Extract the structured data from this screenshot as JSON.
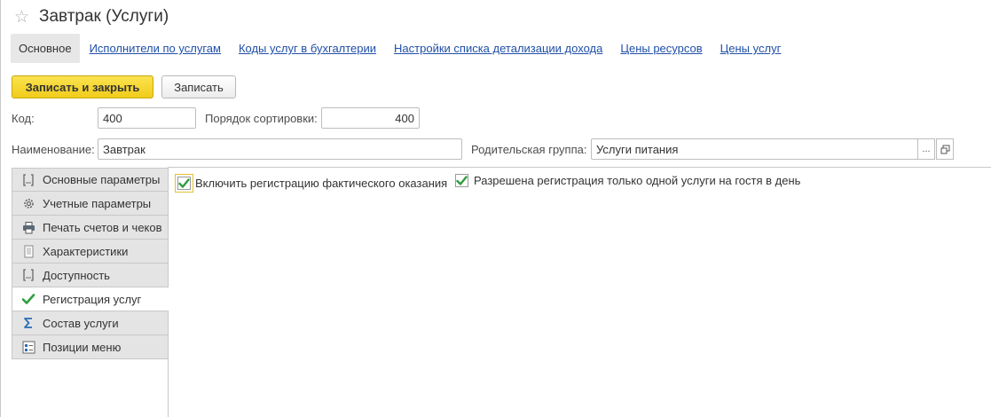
{
  "window": {
    "title": "Завтрак (Услуги)",
    "favorite_icon": "star-outline-icon"
  },
  "nav": {
    "active": "Основное",
    "links": [
      "Исполнители по услугам",
      "Коды услуг в бухгалтерии",
      "Настройки списка детализации дохода",
      "Цены ресурсов",
      "Цены услуг"
    ]
  },
  "toolbar": {
    "save_close_label": "Записать и закрыть",
    "save_label": "Записать"
  },
  "form": {
    "code_label": "Код:",
    "code_value": "400",
    "sort_label": "Порядок сортировки:",
    "sort_value": "400",
    "name_label": "Наименование:",
    "name_value": "Завтрак",
    "parent_label": "Родительская группа:",
    "parent_value": "Услуги питания",
    "select_button": "...",
    "open_button_icon": "open-window-icon"
  },
  "tabs": [
    {
      "label": "Основные параметры",
      "icon": "bracket-form-icon"
    },
    {
      "label": "Учетные параметры",
      "icon": "gear-icon"
    },
    {
      "label": "Печать счетов и чеков",
      "icon": "printer-icon"
    },
    {
      "label": "Характеристики",
      "icon": "document-icon"
    },
    {
      "label": "Доступность",
      "icon": "bracket-form-icon"
    },
    {
      "label": "Регистрация услуг",
      "icon": "green-checkmark-icon",
      "active": true
    },
    {
      "label": "Состав услуги",
      "icon": "sigma-icon"
    },
    {
      "label": "Позиции меню",
      "icon": "menu-list-icon"
    }
  ],
  "checkboxes": [
    {
      "label": "Включить регистрацию фактического оказания",
      "checked": true
    },
    {
      "label": "Разрешена регистрация только одной услуги на гостя в день",
      "checked": true
    }
  ],
  "colors": {
    "primary_button": "#f5d633",
    "link": "#1f4fa8",
    "check_green": "#2e9e3e"
  }
}
